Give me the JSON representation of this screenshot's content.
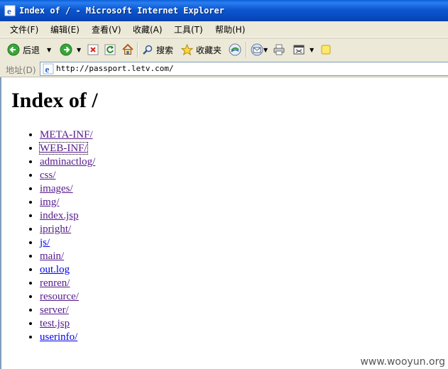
{
  "window": {
    "title": "Index of / - Microsoft Internet Explorer"
  },
  "menu": [
    {
      "label": "文件(F)"
    },
    {
      "label": "编辑(E)"
    },
    {
      "label": "查看(V)"
    },
    {
      "label": "收藏(A)"
    },
    {
      "label": "工具(T)"
    },
    {
      "label": "帮助(H)"
    }
  ],
  "toolbar": {
    "back_label": "后退",
    "search_label": "搜索",
    "favorites_label": "收藏夹"
  },
  "address": {
    "label": "地址(D)",
    "url": "http://passport.letv.com/"
  },
  "page": {
    "heading": "Index of /",
    "entries": [
      {
        "label": "META-INF/",
        "visited": true
      },
      {
        "label": "WEB-INF/",
        "visited": true,
        "focused": true
      },
      {
        "label": "adminactlog/",
        "visited": true
      },
      {
        "label": "css/",
        "visited": true
      },
      {
        "label": "images/",
        "visited": true
      },
      {
        "label": "img/",
        "visited": true
      },
      {
        "label": "index.jsp",
        "visited": true
      },
      {
        "label": "ipright/",
        "visited": true
      },
      {
        "label": "js/",
        "visited": false
      },
      {
        "label": "main/",
        "visited": true
      },
      {
        "label": "out.log",
        "visited": false
      },
      {
        "label": "renren/",
        "visited": true
      },
      {
        "label": "resource/",
        "visited": true
      },
      {
        "label": "server/",
        "visited": true
      },
      {
        "label": "test.jsp",
        "visited": true
      },
      {
        "label": "userinfo/",
        "visited": false
      }
    ]
  },
  "watermark": "www.wooyun.org",
  "colors": {
    "link": "#0000ee",
    "visited_link": "#551a8b",
    "titlebar": "#0b57d0"
  }
}
